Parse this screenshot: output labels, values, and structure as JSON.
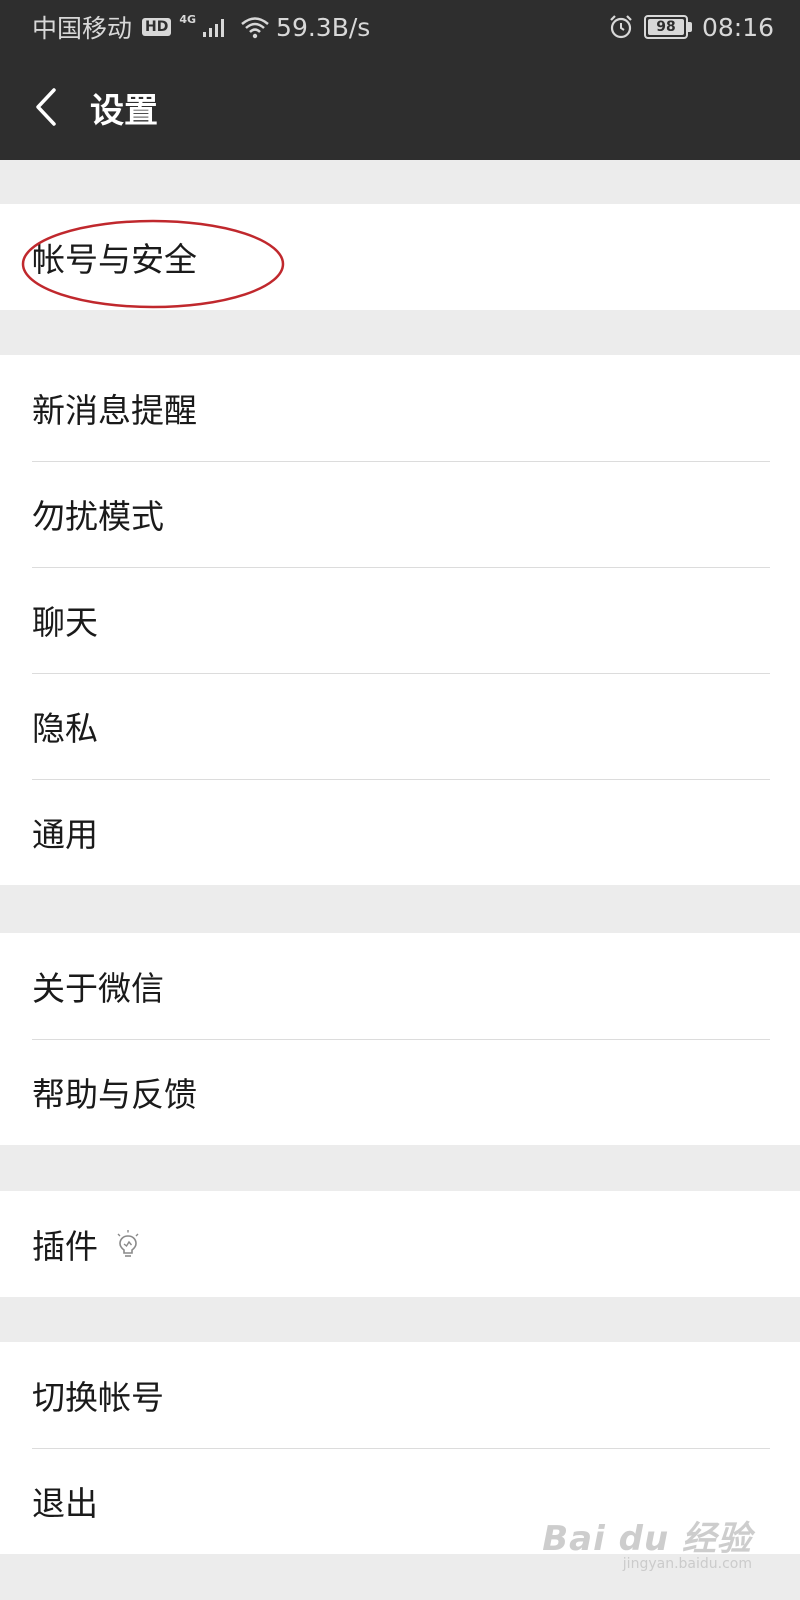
{
  "status_bar": {
    "carrier": "中国移动",
    "hd": "HD",
    "network": "4G",
    "speed": "59.3B/s",
    "battery": "98",
    "time": "08:16"
  },
  "nav": {
    "title": "设置"
  },
  "groups": [
    {
      "items": [
        {
          "label": "帐号与安全"
        }
      ]
    },
    {
      "items": [
        {
          "label": "新消息提醒"
        },
        {
          "label": "勿扰模式"
        },
        {
          "label": "聊天"
        },
        {
          "label": "隐私"
        },
        {
          "label": "通用"
        }
      ]
    },
    {
      "items": [
        {
          "label": "关于微信"
        },
        {
          "label": "帮助与反馈"
        }
      ]
    },
    {
      "items": [
        {
          "label": "插件",
          "icon": "lightbulb-icon"
        }
      ]
    },
    {
      "items": [
        {
          "label": "切换帐号"
        },
        {
          "label": "退出"
        }
      ]
    }
  ],
  "watermark": {
    "logo": "Bai du 经验",
    "url": "jingyan.baidu.com"
  },
  "colors": {
    "header_bg": "#2e2e2e",
    "page_bg": "#ececec",
    "annotation": "#c0282d"
  }
}
